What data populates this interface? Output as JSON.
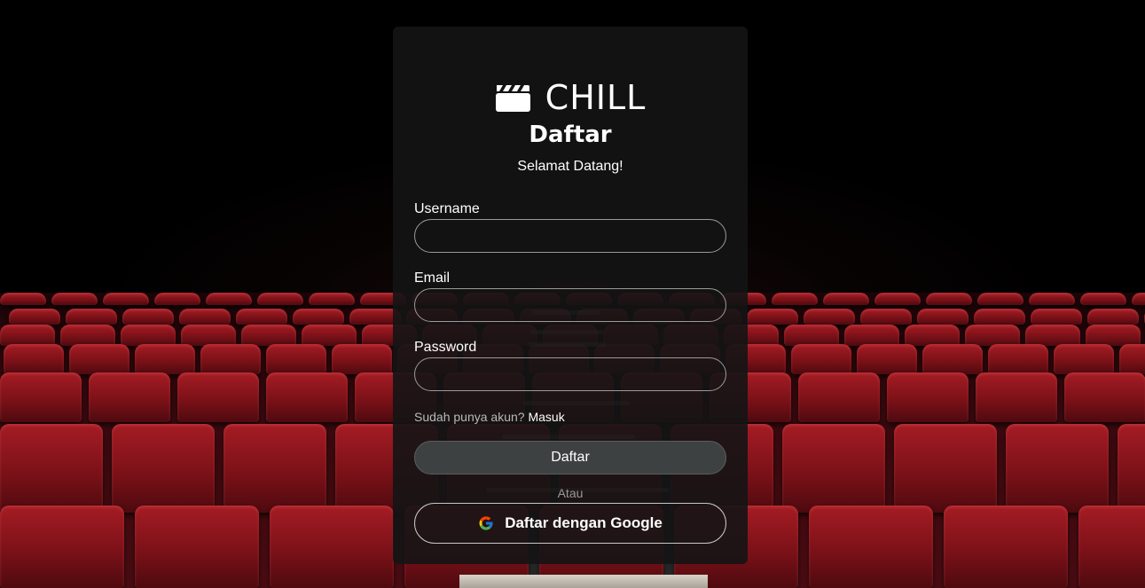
{
  "brand": {
    "name": "CHILL",
    "logo_icon": "clapperboard-icon"
  },
  "form": {
    "title": "Daftar",
    "subtitle": "Selamat Datang!",
    "fields": {
      "username": {
        "label": "Username",
        "value": "",
        "placeholder": ""
      },
      "email": {
        "label": "Email",
        "value": "",
        "placeholder": ""
      },
      "password": {
        "label": "Password",
        "value": "",
        "placeholder": ""
      }
    },
    "signin_prompt": "Sudah punya akun?",
    "signin_link": "Masuk",
    "submit_label": "Daftar",
    "divider": "Atau",
    "google_label": "Daftar dengan Google",
    "google_icon": "google-icon"
  },
  "colors": {
    "card_bg": "#141415",
    "primary_button": "#3d4142",
    "seat_red": "#a51c24"
  }
}
